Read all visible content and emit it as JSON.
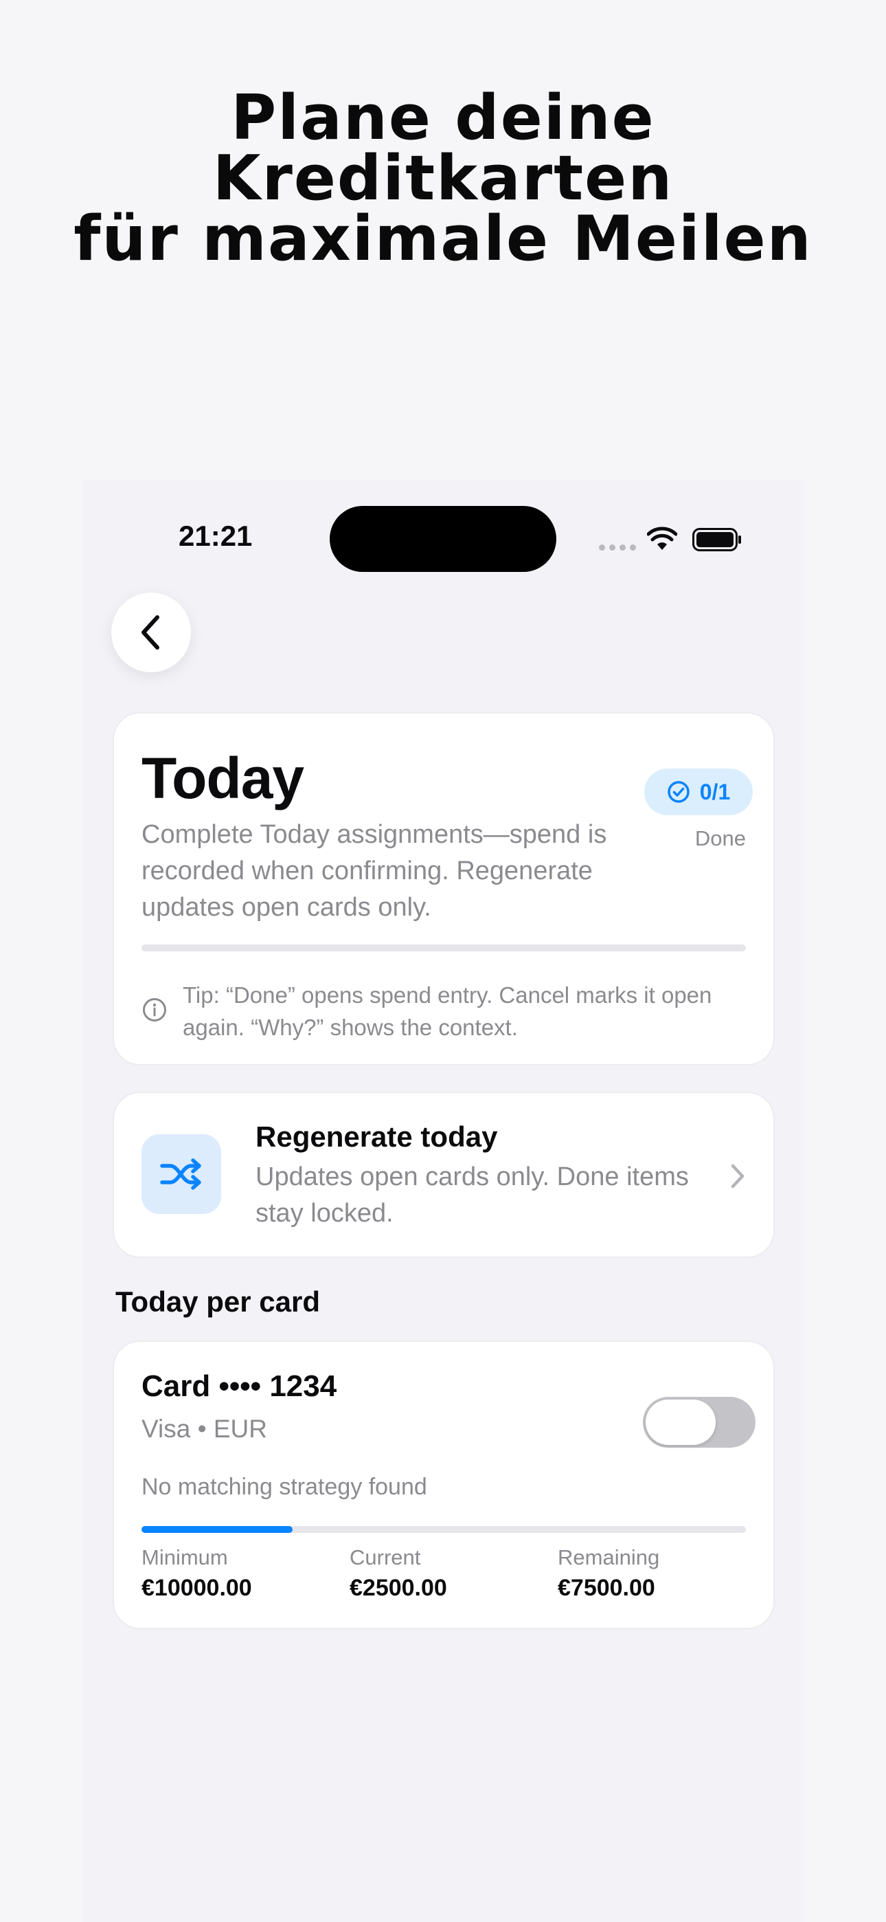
{
  "headline": {
    "line1": "Plane deine Kreditkarten",
    "line2": "für maximale Meilen"
  },
  "status_bar": {
    "time": "21:21"
  },
  "icons": {
    "back": "chevron-left-icon",
    "wifi": "wifi-icon",
    "battery": "battery-icon",
    "check": "check-circle-icon",
    "info": "info-icon",
    "shuffle": "shuffle-icon",
    "chevron": "chevron-right-icon"
  },
  "colors": {
    "accent": "#0a84ff",
    "background": "#f2f2f7",
    "secondary_text": "#8a8a8f"
  },
  "today": {
    "title": "Today",
    "description": "Complete Today assignments—spend is recorded when confirming. Regenerate updates open cards only.",
    "progress_badge": "0/1",
    "progress_caption": "Done",
    "progress_fraction": 0,
    "tip": "Tip: “Done” opens spend entry. Cancel marks it open again. “Why?” shows the context."
  },
  "regenerate": {
    "title": "Regenerate today",
    "subtitle": "Updates open cards only. Done items stay locked."
  },
  "per_card": {
    "section_title": "Today per card",
    "cards": [
      {
        "name": "Card •••• 1234",
        "meta": "Visa • EUR",
        "enabled": false,
        "note": "No matching strategy found",
        "progress_fraction": 0.25,
        "stats": [
          {
            "label": "Minimum",
            "value": "€10000.00"
          },
          {
            "label": "Current",
            "value": "€2500.00"
          },
          {
            "label": "Remaining",
            "value": "€7500.00"
          }
        ]
      }
    ]
  }
}
